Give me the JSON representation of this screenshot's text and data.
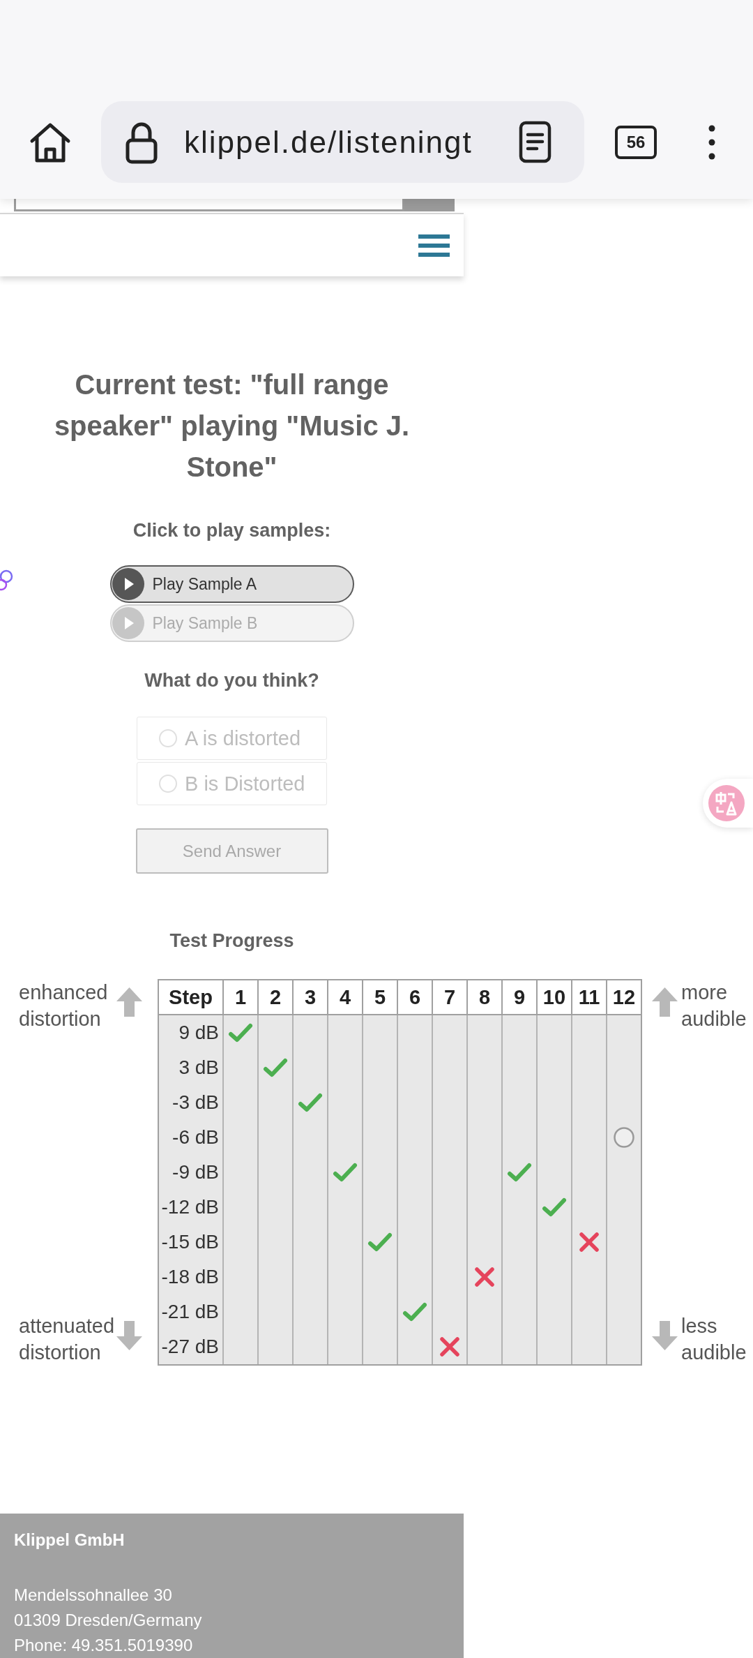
{
  "browser": {
    "url": "klippel.de/listeningt",
    "tab_count": "56"
  },
  "test": {
    "title": "Current test: \"full range speaker\" playing \"Music J. Stone\"",
    "play_prompt": "Click to play samples:",
    "samples": [
      {
        "label": "Play Sample A",
        "disabled": false
      },
      {
        "label": "Play Sample B",
        "disabled": true
      }
    ],
    "question": "What do you think?",
    "answers": [
      {
        "label": "A is distorted",
        "selected": false,
        "disabled": true
      },
      {
        "label": "B is Distorted",
        "selected": false,
        "disabled": true
      }
    ],
    "submit": {
      "label": "Send Answer",
      "disabled": true
    }
  },
  "progress": {
    "title": "Test Progress",
    "notes_left": [
      {
        "text": "enhanced distortion",
        "kind": "up"
      },
      {
        "text": "attenuated distortion",
        "kind": "down"
      }
    ],
    "notes_right": [
      {
        "text": "more audible",
        "kind": "up"
      },
      {
        "text": "less audible",
        "kind": "down"
      }
    ],
    "columns": [
      "Step",
      "1",
      "2",
      "3",
      "4",
      "5",
      "6",
      "7",
      "8",
      "9",
      "10",
      "11",
      "12"
    ],
    "rows": [
      {
        "label": "9 dB",
        "cells": [
          {
            "kind": "correct"
          },
          {
            "kind": "empty"
          },
          {
            "kind": "empty"
          },
          {
            "kind": "empty"
          },
          {
            "kind": "empty"
          },
          {
            "kind": "empty"
          },
          {
            "kind": "empty"
          },
          {
            "kind": "empty"
          },
          {
            "kind": "empty"
          },
          {
            "kind": "empty"
          },
          {
            "kind": "empty"
          },
          {
            "kind": "empty"
          }
        ]
      },
      {
        "label": "3 dB",
        "cells": [
          {
            "kind": "empty"
          },
          {
            "kind": "correct"
          },
          {
            "kind": "empty"
          },
          {
            "kind": "empty"
          },
          {
            "kind": "empty"
          },
          {
            "kind": "empty"
          },
          {
            "kind": "empty"
          },
          {
            "kind": "empty"
          },
          {
            "kind": "empty"
          },
          {
            "kind": "empty"
          },
          {
            "kind": "empty"
          },
          {
            "kind": "empty"
          }
        ]
      },
      {
        "label": "-3 dB",
        "cells": [
          {
            "kind": "empty"
          },
          {
            "kind": "empty"
          },
          {
            "kind": "correct"
          },
          {
            "kind": "empty"
          },
          {
            "kind": "empty"
          },
          {
            "kind": "empty"
          },
          {
            "kind": "empty"
          },
          {
            "kind": "empty"
          },
          {
            "kind": "empty"
          },
          {
            "kind": "empty"
          },
          {
            "kind": "empty"
          },
          {
            "kind": "empty"
          }
        ]
      },
      {
        "label": "-6 dB",
        "cells": [
          {
            "kind": "empty"
          },
          {
            "kind": "empty"
          },
          {
            "kind": "empty"
          },
          {
            "kind": "empty"
          },
          {
            "kind": "empty"
          },
          {
            "kind": "empty"
          },
          {
            "kind": "empty"
          },
          {
            "kind": "empty"
          },
          {
            "kind": "empty"
          },
          {
            "kind": "empty"
          },
          {
            "kind": "empty"
          },
          {
            "kind": "current"
          }
        ]
      },
      {
        "label": "-9 dB",
        "cells": [
          {
            "kind": "empty"
          },
          {
            "kind": "empty"
          },
          {
            "kind": "empty"
          },
          {
            "kind": "correct"
          },
          {
            "kind": "empty"
          },
          {
            "kind": "empty"
          },
          {
            "kind": "empty"
          },
          {
            "kind": "empty"
          },
          {
            "kind": "correct"
          },
          {
            "kind": "empty"
          },
          {
            "kind": "empty"
          },
          {
            "kind": "empty"
          }
        ]
      },
      {
        "label": "-12 dB",
        "cells": [
          {
            "kind": "empty"
          },
          {
            "kind": "empty"
          },
          {
            "kind": "empty"
          },
          {
            "kind": "empty"
          },
          {
            "kind": "empty"
          },
          {
            "kind": "empty"
          },
          {
            "kind": "empty"
          },
          {
            "kind": "empty"
          },
          {
            "kind": "empty"
          },
          {
            "kind": "correct"
          },
          {
            "kind": "empty"
          },
          {
            "kind": "empty"
          }
        ]
      },
      {
        "label": "-15 dB",
        "cells": [
          {
            "kind": "empty"
          },
          {
            "kind": "empty"
          },
          {
            "kind": "empty"
          },
          {
            "kind": "empty"
          },
          {
            "kind": "correct"
          },
          {
            "kind": "empty"
          },
          {
            "kind": "empty"
          },
          {
            "kind": "empty"
          },
          {
            "kind": "empty"
          },
          {
            "kind": "empty"
          },
          {
            "kind": "wrong"
          },
          {
            "kind": "empty"
          }
        ]
      },
      {
        "label": "-18 dB",
        "cells": [
          {
            "kind": "empty"
          },
          {
            "kind": "empty"
          },
          {
            "kind": "empty"
          },
          {
            "kind": "empty"
          },
          {
            "kind": "empty"
          },
          {
            "kind": "empty"
          },
          {
            "kind": "empty"
          },
          {
            "kind": "wrong"
          },
          {
            "kind": "empty"
          },
          {
            "kind": "empty"
          },
          {
            "kind": "empty"
          },
          {
            "kind": "empty"
          }
        ]
      },
      {
        "label": "-21 dB",
        "cells": [
          {
            "kind": "empty"
          },
          {
            "kind": "empty"
          },
          {
            "kind": "empty"
          },
          {
            "kind": "empty"
          },
          {
            "kind": "empty"
          },
          {
            "kind": "correct"
          },
          {
            "kind": "empty"
          },
          {
            "kind": "empty"
          },
          {
            "kind": "empty"
          },
          {
            "kind": "empty"
          },
          {
            "kind": "empty"
          },
          {
            "kind": "empty"
          }
        ]
      },
      {
        "label": "-27 dB",
        "cells": [
          {
            "kind": "empty"
          },
          {
            "kind": "empty"
          },
          {
            "kind": "empty"
          },
          {
            "kind": "empty"
          },
          {
            "kind": "empty"
          },
          {
            "kind": "empty"
          },
          {
            "kind": "wrong"
          },
          {
            "kind": "empty"
          },
          {
            "kind": "empty"
          },
          {
            "kind": "empty"
          },
          {
            "kind": "empty"
          },
          {
            "kind": "empty"
          }
        ]
      }
    ]
  },
  "footer": {
    "company": "Klippel GmbH",
    "lines": [
      "Mendelssohnallee 30",
      "01309 Dresden/Germany",
      "Phone: 49.351.5019390"
    ]
  }
}
